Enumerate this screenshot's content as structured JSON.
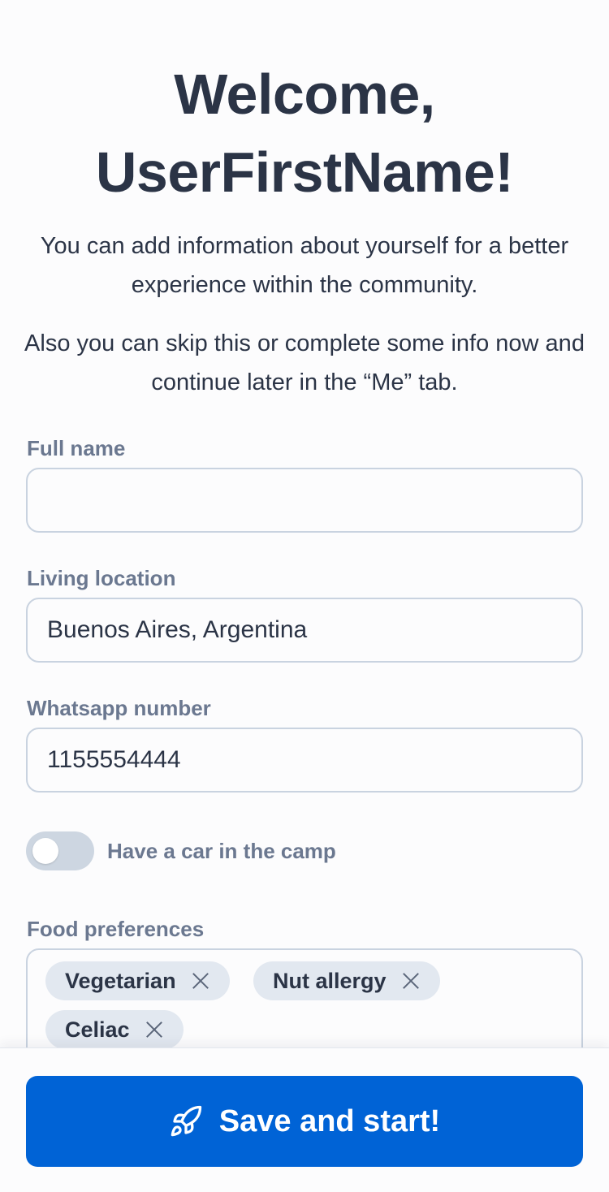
{
  "header": {
    "title_line1": "Welcome,",
    "title_line2": "UserFirstName!",
    "intro_p1": "You can add information about yourself for a better experience within the community.",
    "intro_p2": "Also you can skip this or complete some info now and continue later in the “Me” tab."
  },
  "form": {
    "full_name": {
      "label": "Full name",
      "value": ""
    },
    "living_location": {
      "label": "Living location",
      "value": "Buenos Aires, Argentina"
    },
    "whatsapp": {
      "label": "Whatsapp number",
      "value": "1155554444"
    },
    "car_toggle": {
      "label": "Have a car in the camp",
      "enabled": false
    },
    "food_preferences": {
      "label": "Food preferences",
      "tags": [
        "Vegetarian",
        "Nut allergy",
        "Celiac"
      ]
    }
  },
  "footer": {
    "cta_label": "Save and start!",
    "cta_icon": "rocket-icon"
  },
  "colors": {
    "primary": "#0063d6",
    "text": "#2b3446",
    "label": "#6b7890",
    "chip_bg": "#e2e8f0",
    "border": "#c9d3e0"
  }
}
